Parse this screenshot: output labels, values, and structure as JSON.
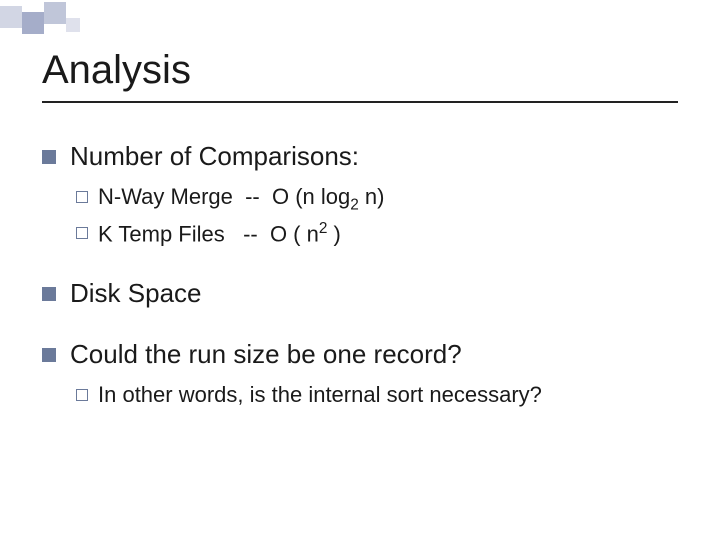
{
  "title": "Analysis",
  "points": {
    "p1": {
      "text": "Number of Comparisons:",
      "sub": {
        "s1_prefix": "N-Way Merge  --  O (n log",
        "s1_sub": "2",
        "s1_suffix": " n)",
        "s2_prefix": "K Temp Files   --  O ( n",
        "s2_sup": "2",
        "s2_suffix": " )"
      }
    },
    "p2": {
      "text": "Disk Space"
    },
    "p3": {
      "text": "Could the run size be one record?",
      "sub": {
        "s1": "In other words, is the internal sort necessary?"
      }
    }
  }
}
